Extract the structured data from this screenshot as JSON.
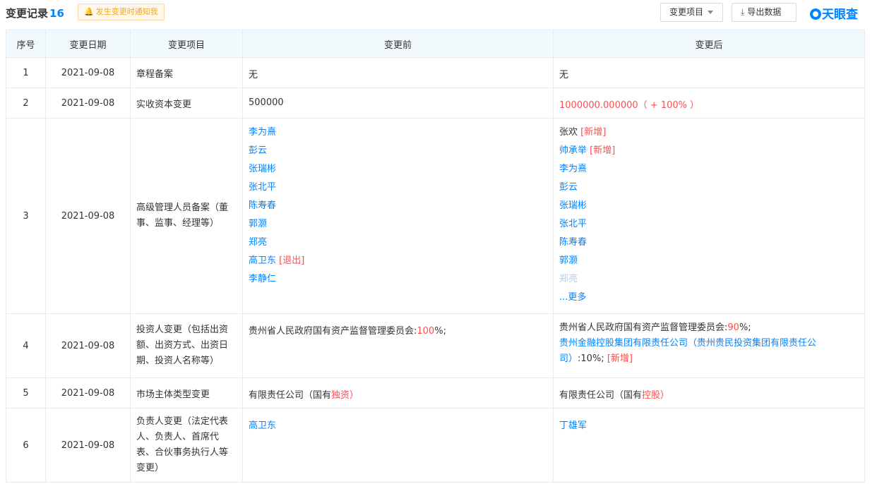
{
  "header": {
    "title": "变更记录",
    "count": "16",
    "notify_label": "发生变更时通知我",
    "type_button": "变更项目",
    "export_button": "导出数据",
    "brand": "天眼查"
  },
  "columns": [
    "序号",
    "变更日期",
    "变更项目",
    "变更前",
    "变更后"
  ],
  "rows": [
    {
      "idx": "1",
      "date": "2021-09-08",
      "item": "章程备案",
      "before": "无",
      "after": "无"
    },
    {
      "idx": "2",
      "date": "2021-09-08",
      "item": "实收资本变更",
      "before": "500000",
      "after": "1000000.000000（ + 100% ）"
    },
    {
      "idx": "3",
      "date": "2021-09-08",
      "item": "高级管理人员备案（董事、监事、经理等）",
      "before": [
        "李为熹",
        "彭云",
        "张瑞彬",
        "张北平",
        "陈寿春",
        "郭灏",
        "郑亮",
        "高卫东",
        "李静仁"
      ],
      "before_tag_exit": "[退出]",
      "after": [
        "张欢",
        "帅承举",
        "李为熹",
        "彭云",
        "张瑞彬",
        "张北平",
        "陈寿春",
        "郭灏",
        "郑亮"
      ],
      "after_tag_new": "[新增]",
      "after_more": "...更多"
    },
    {
      "idx": "4",
      "date": "2021-09-08",
      "item": "投资人变更（包括出资额、出资方式、出资日期、投资人名称等）",
      "before_text": "贵州省人民政府国有资产监督管理委员会:",
      "before_pct": "100",
      "before_suffix": "%;",
      "after_text": "贵州省人民政府国有资产监督管理委员会:",
      "after_pct": "90",
      "after_suffix": "%;",
      "after_line2_link": "贵州金融控股集团有限责任公司（贵州贵民投资集团有限责任公司）",
      "after_line2_tail": ":10%;",
      "after_line2_tag": "[新增]"
    },
    {
      "idx": "5",
      "date": "2021-09-08",
      "item": "市场主体类型变更",
      "before_pre": "有限责任公司",
      "before_paren_open": "（国有",
      "before_hl": "独资",
      "before_paren_close": "）",
      "after_pre": "有限责任公司",
      "after_paren_open": "（国有",
      "after_hl": "控股",
      "after_paren_close": "）"
    },
    {
      "idx": "6",
      "date": "2021-09-08",
      "item": "负责人变更（法定代表人、负责人、首席代表、合伙事务执行人等变更）",
      "before": "高卫东",
      "after": "丁雄军"
    }
  ]
}
